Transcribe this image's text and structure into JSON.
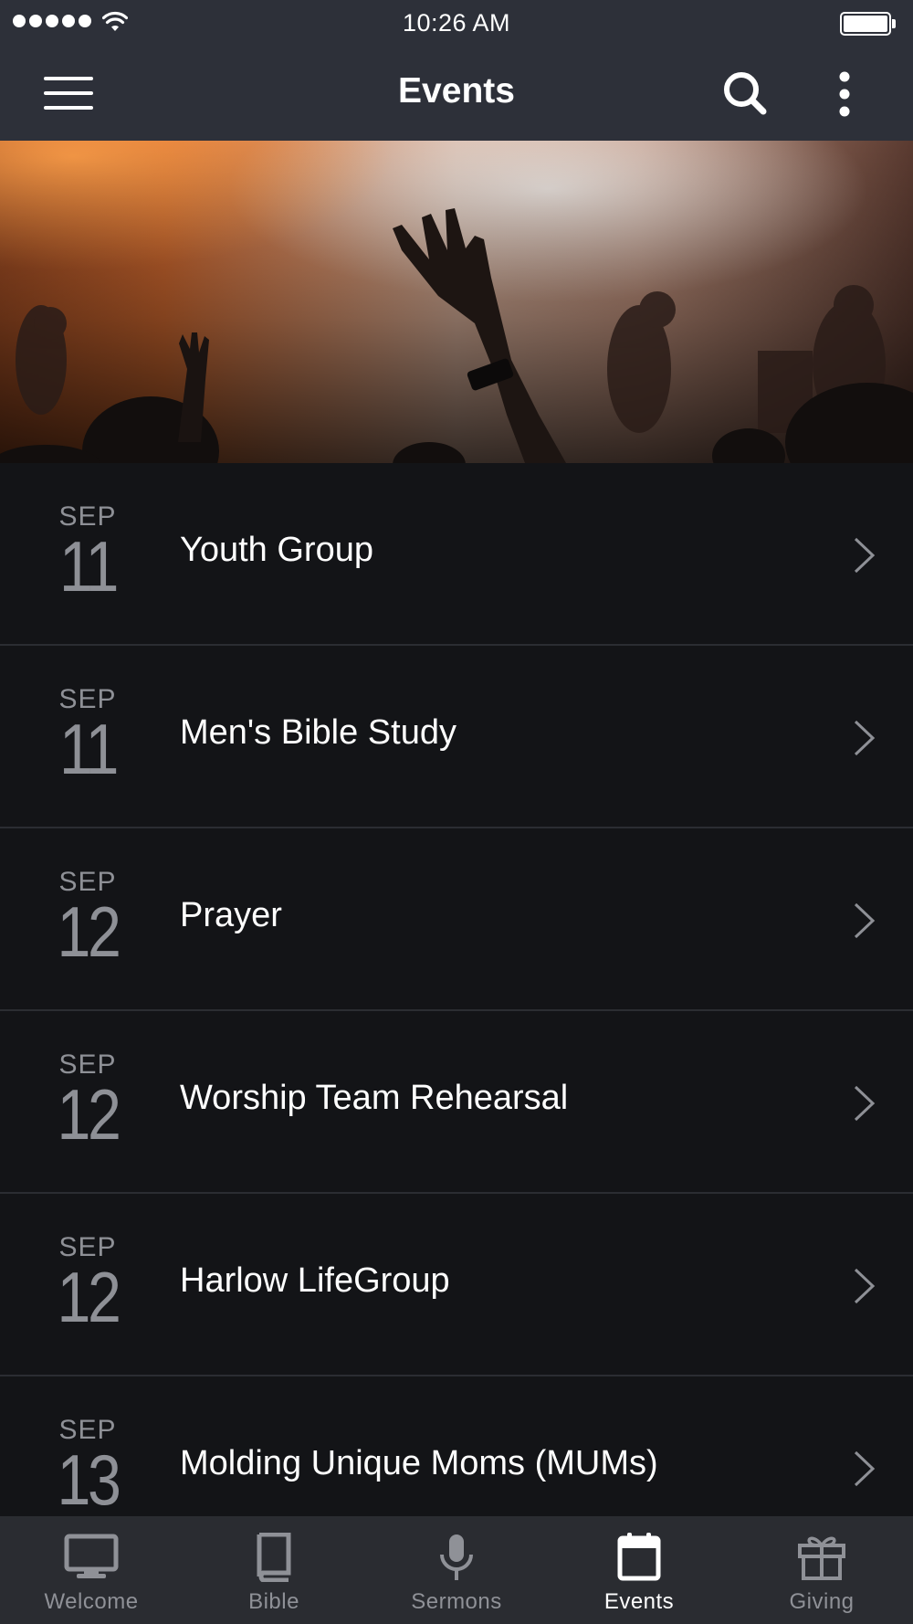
{
  "status_bar": {
    "time": "10:26 AM"
  },
  "header": {
    "title": "Events"
  },
  "events": [
    {
      "month": "SEP",
      "day": "11",
      "name": "Youth Group"
    },
    {
      "month": "SEP",
      "day": "11",
      "name": "Men's Bible Study"
    },
    {
      "month": "SEP",
      "day": "12",
      "name": "Prayer"
    },
    {
      "month": "SEP",
      "day": "12",
      "name": "Worship Team Rehearsal"
    },
    {
      "month": "SEP",
      "day": "12",
      "name": "Harlow LifeGroup"
    },
    {
      "month": "SEP",
      "day": "13",
      "name": "Molding Unique Moms (MUMs)"
    }
  ],
  "tabs": [
    {
      "label": "Welcome",
      "icon": "monitor-icon",
      "active": false
    },
    {
      "label": "Bible",
      "icon": "book-icon",
      "active": false
    },
    {
      "label": "Sermons",
      "icon": "microphone-icon",
      "active": false
    },
    {
      "label": "Events",
      "icon": "calendar-icon",
      "active": true
    },
    {
      "label": "Giving",
      "icon": "gift-icon",
      "active": false
    }
  ],
  "colors": {
    "header_bg": "#2d3039",
    "list_bg": "#131417",
    "tabbar_bg": "#2a2c31",
    "inactive_tab": "#8f9197",
    "active_tab": "#ffffff"
  }
}
